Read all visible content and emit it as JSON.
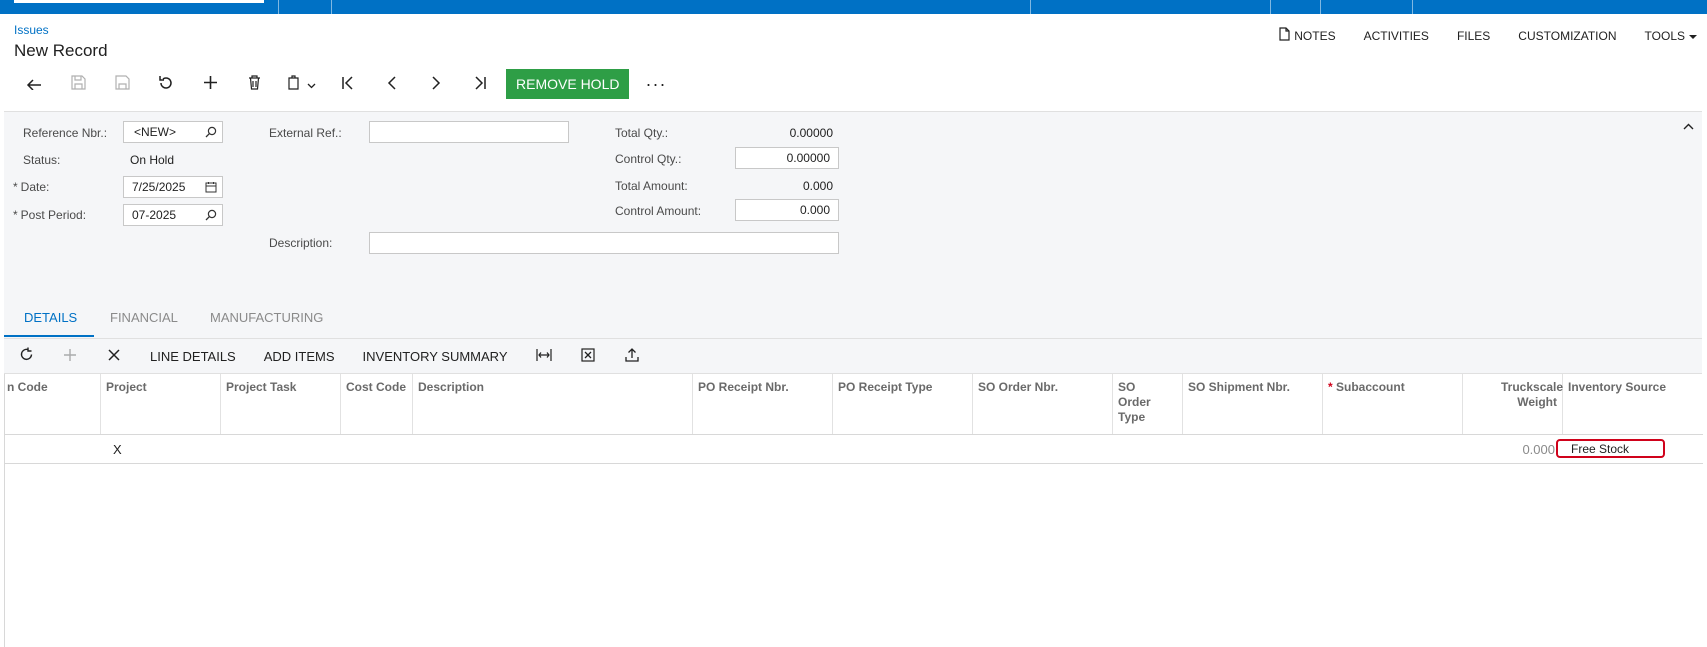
{
  "topbar": {
    "color": "#0071c5"
  },
  "breadcrumb": "Issues",
  "page_title": "New Record",
  "actions": [
    {
      "label": "NOTES",
      "icon": "document-icon"
    },
    {
      "label": "ACTIVITIES"
    },
    {
      "label": "FILES"
    },
    {
      "label": "CUSTOMIZATION"
    },
    {
      "label": "TOOLS",
      "icon": "caret-down-icon"
    }
  ],
  "toolbar": {
    "icons": [
      "undo-back-icon",
      "save-icon",
      "save-close-icon",
      "cancel-icon",
      "add-icon",
      "delete-icon",
      "copy-paste-icon",
      "first-record-icon",
      "previous-record-icon",
      "next-record-icon",
      "last-record-icon"
    ],
    "primary_button": "REMOVE HOLD",
    "more": "···",
    "primary_color": "#2e9e46"
  },
  "form": {
    "reference_nbr": {
      "label": "Reference Nbr.:",
      "value": "<NEW>"
    },
    "status": {
      "label": "Status:",
      "value": "On Hold"
    },
    "date": {
      "label": "Date:",
      "value": "7/25/2025"
    },
    "post_period": {
      "label": "Post Period:",
      "value": "07-2025"
    },
    "external_ref": {
      "label": "External Ref.:",
      "value": ""
    },
    "description": {
      "label": "Description:",
      "value": ""
    },
    "total_qty": {
      "label": "Total Qty.:",
      "value": "0.00000"
    },
    "control_qty": {
      "label": "Control Qty.:",
      "value": "0.00000"
    },
    "total_amount": {
      "label": "Total Amount:",
      "value": "0.000"
    },
    "control_amount": {
      "label": "Control Amount:",
      "value": "0.000"
    },
    "required_marker": "*"
  },
  "tabs": [
    {
      "label": "DETAILS",
      "active": true
    },
    {
      "label": "FINANCIAL",
      "active": false
    },
    {
      "label": "MANUFACTURING",
      "active": false
    }
  ],
  "grid_toolbar": {
    "buttons": [
      "LINE DETAILS",
      "ADD ITEMS",
      "INVENTORY SUMMARY"
    ]
  },
  "grid": {
    "columns": [
      "n Code",
      "Project",
      "Project Task",
      "Cost Code",
      "Description",
      "PO Receipt Nbr.",
      "PO Receipt Type",
      "SO Order Nbr.",
      "SO Order Type",
      "SO Shipment Nbr.",
      "Subaccount",
      "Truckscale Weight",
      "Inventory Source"
    ],
    "rows": [
      {
        "project": "X",
        "truckscale_weight": "0.000",
        "inventory_source": "Free Stock"
      }
    ],
    "highlight_color": "#d0021b"
  }
}
